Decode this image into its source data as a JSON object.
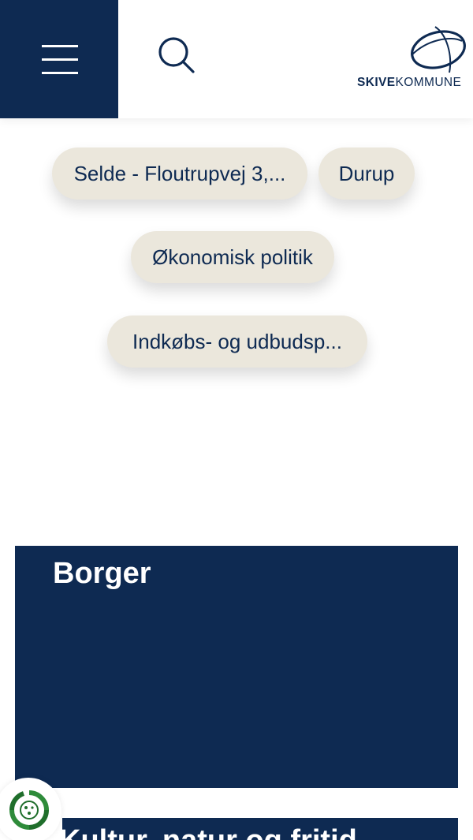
{
  "header": {
    "menu_icon": "hamburger-menu-icon",
    "search_icon": "search-icon",
    "logo": {
      "bold_part": "SKIVE",
      "light_part": "KOMMUNE"
    }
  },
  "chips": [
    {
      "label": "Selde - Floutrupvej 3,..."
    },
    {
      "label": "Durup"
    },
    {
      "label": "Økonomisk politik"
    },
    {
      "label": "Indkøbs- og udbudsp..."
    }
  ],
  "cards": [
    {
      "title": "Borger"
    },
    {
      "title": "Kultur, natur og fritid"
    }
  ],
  "cookie_icon": "cookie-consent-icon",
  "colors": {
    "navy": "#0e2a52",
    "chip_bg": "#ebe7dc",
    "green": "#2e8b3a"
  }
}
